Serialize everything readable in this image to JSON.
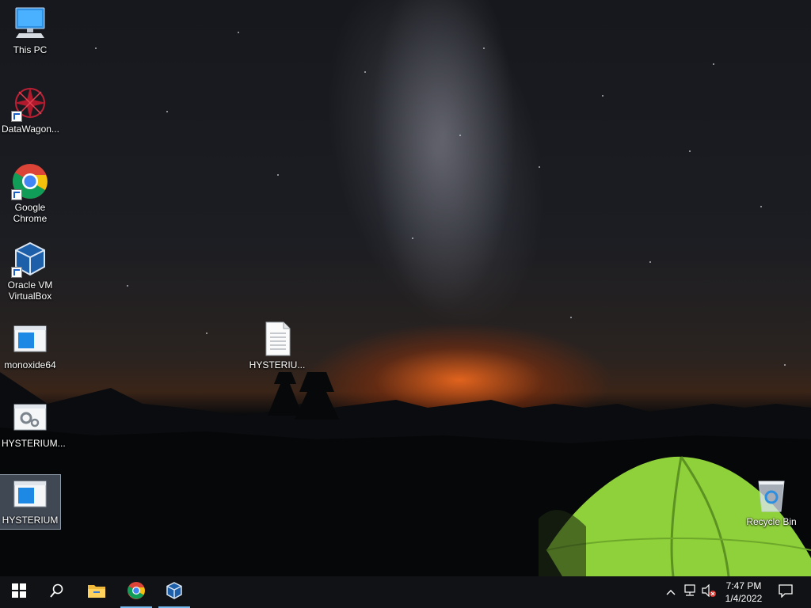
{
  "desktop": {
    "icons": [
      {
        "label": "This PC",
        "icon": "computer-icon"
      },
      {
        "label": "DataWagon...",
        "icon": "datawagon-icon"
      },
      {
        "label": "Google Chrome",
        "icon": "chrome-icon"
      },
      {
        "label": "Oracle VM VirtualBox",
        "icon": "virtualbox-icon"
      },
      {
        "label": "monoxide64",
        "icon": "app-window-icon"
      },
      {
        "label": "HYSTERIUM...",
        "icon": "settings-app-icon"
      },
      {
        "label": "HYSTERIUM",
        "icon": "app-window-icon",
        "selected": true
      },
      {
        "label": "HYSTERIU...",
        "icon": "text-document-icon"
      },
      {
        "label": "Recycle Bin",
        "icon": "recycle-bin-icon"
      }
    ]
  },
  "taskbar": {
    "pinned": [
      {
        "name": "start",
        "icon": "windows-start-icon"
      },
      {
        "name": "search",
        "icon": "search-icon"
      },
      {
        "name": "file-explorer",
        "icon": "folder-icon"
      },
      {
        "name": "chrome",
        "icon": "chrome-icon",
        "active": true
      },
      {
        "name": "virtualbox",
        "icon": "virtualbox-icon",
        "active": true
      }
    ],
    "tray": {
      "icons": [
        "chevron-up-icon",
        "network-icon",
        "volume-muted-icon",
        "notification-icon"
      ],
      "time": "7:47 PM",
      "date": "1/4/2022"
    }
  },
  "colors": {
    "taskbar": "#101215",
    "active_indicator": "#76b9ed",
    "tent_green": "#8fd13a"
  }
}
